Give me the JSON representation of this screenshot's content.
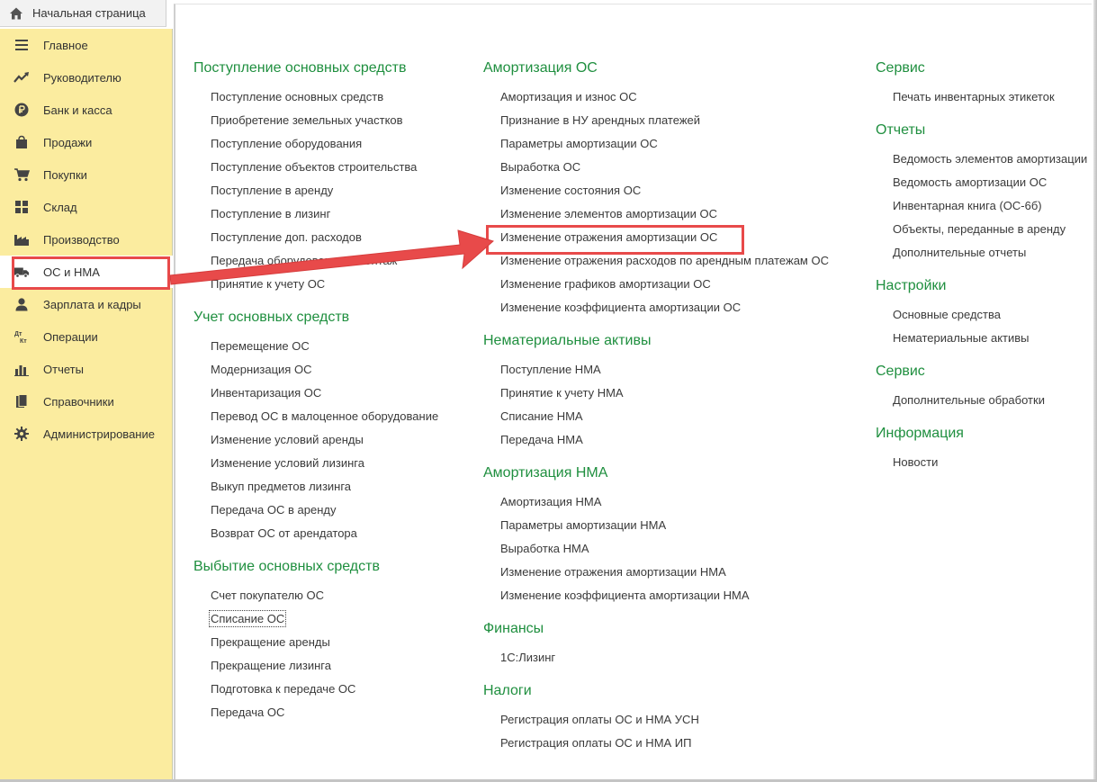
{
  "home_tab": {
    "label": "Начальная страница",
    "icon": "home-icon"
  },
  "sidebar": {
    "items": [
      {
        "label": "Главное",
        "icon": "menu-lines-icon"
      },
      {
        "label": "Руководителю",
        "icon": "trend-icon"
      },
      {
        "label": "Банк и касса",
        "icon": "ruble-coin-icon"
      },
      {
        "label": "Продажи",
        "icon": "shopping-bag-icon"
      },
      {
        "label": "Покупки",
        "icon": "shopping-cart-icon"
      },
      {
        "label": "Склад",
        "icon": "grid-icon"
      },
      {
        "label": "Производство",
        "icon": "factory-icon"
      },
      {
        "label": "ОС и НМА",
        "icon": "truck-icon"
      },
      {
        "label": "Зарплата и кадры",
        "icon": "person-icon"
      },
      {
        "label": "Операции",
        "icon": "dt-kt-icon"
      },
      {
        "label": "Отчеты",
        "icon": "bar-chart-icon"
      },
      {
        "label": "Справочники",
        "icon": "books-icon"
      },
      {
        "label": "Администрирование",
        "icon": "gear-icon"
      }
    ],
    "active_index": 7,
    "colors": {
      "background": "#fbec9f",
      "active": "#ffffff"
    }
  },
  "dt_kt_glyph": {
    "top": "Дт",
    "bottom": "Кт"
  },
  "columns": [
    {
      "sections": [
        {
          "title": "Поступление основных средств",
          "links": [
            "Поступление основных средств",
            "Приобретение земельных участков",
            "Поступление оборудования",
            "Поступление объектов строительства",
            "Поступление в аренду",
            "Поступление в лизинг",
            "Поступление доп. расходов",
            "Передача оборудования в монтаж",
            "Принятие к учету ОС"
          ]
        },
        {
          "title": "Учет основных средств",
          "links": [
            "Перемещение ОС",
            "Модернизация ОС",
            "Инвентаризация ОС",
            "Перевод ОС в малоценное оборудование",
            "Изменение условий аренды",
            "Изменение условий лизинга",
            "Выкуп предметов лизинга",
            "Передача ОС в аренду",
            "Возврат ОС от арендатора"
          ]
        },
        {
          "title": "Выбытие основных средств",
          "links": [
            "Счет покупателю ОС",
            "Списание ОС",
            "Прекращение аренды",
            "Прекращение лизинга",
            "Подготовка к передаче ОС",
            "Передача ОС"
          ]
        }
      ]
    },
    {
      "sections": [
        {
          "title": "Амортизация ОС",
          "links": [
            "Амортизация и износ ОС",
            "Признание в НУ арендных платежей",
            "Параметры амортизации ОС",
            "Выработка ОС",
            "Изменение состояния ОС",
            "Изменение элементов амортизации ОС",
            "Изменение отражения амортизации ОС",
            "Изменение отражения расходов по арендным платежам ОС",
            "Изменение графиков амортизации ОС",
            "Изменение коэффициента амортизации ОС"
          ]
        },
        {
          "title": "Нематериальные активы",
          "links": [
            "Поступление НМА",
            "Принятие к учету НМА",
            "Списание НМА",
            "Передача НМА"
          ]
        },
        {
          "title": "Амортизация НМА",
          "links": [
            "Амортизация НМА",
            "Параметры амортизации НМА",
            "Выработка НМА",
            "Изменение отражения амортизации НМА",
            "Изменение коэффициента амортизации НМА"
          ]
        },
        {
          "title": "Финансы",
          "links": [
            "1С:Лизинг"
          ]
        },
        {
          "title": "Налоги",
          "links": [
            "Регистрация оплаты ОС и НМА УСН",
            "Регистрация оплаты ОС и НМА ИП"
          ]
        }
      ]
    },
    {
      "sections": [
        {
          "title": "Сервис",
          "links": [
            "Печать инвентарных этикеток"
          ]
        },
        {
          "title": "Отчеты",
          "links": [
            "Ведомость элементов амортизации",
            "Ведомость амортизации ОС",
            "Инвентарная книга (ОС-6б)",
            "Объекты, переданные в аренду",
            "Дополнительные отчеты"
          ]
        },
        {
          "title": "Настройки",
          "links": [
            "Основные средства",
            "Нематериальные активы"
          ]
        },
        {
          "title": "Сервис",
          "links": [
            "Дополнительные обработки"
          ]
        },
        {
          "title": "Информация",
          "links": [
            "Новости"
          ]
        }
      ]
    }
  ],
  "focused_link": "Списание ОС",
  "highlighted_link": "Изменение отражения амортизации ОС",
  "colors": {
    "section_title": "#1f8f3f",
    "link": "#3a3a3a",
    "highlight": "#e84a4a"
  }
}
